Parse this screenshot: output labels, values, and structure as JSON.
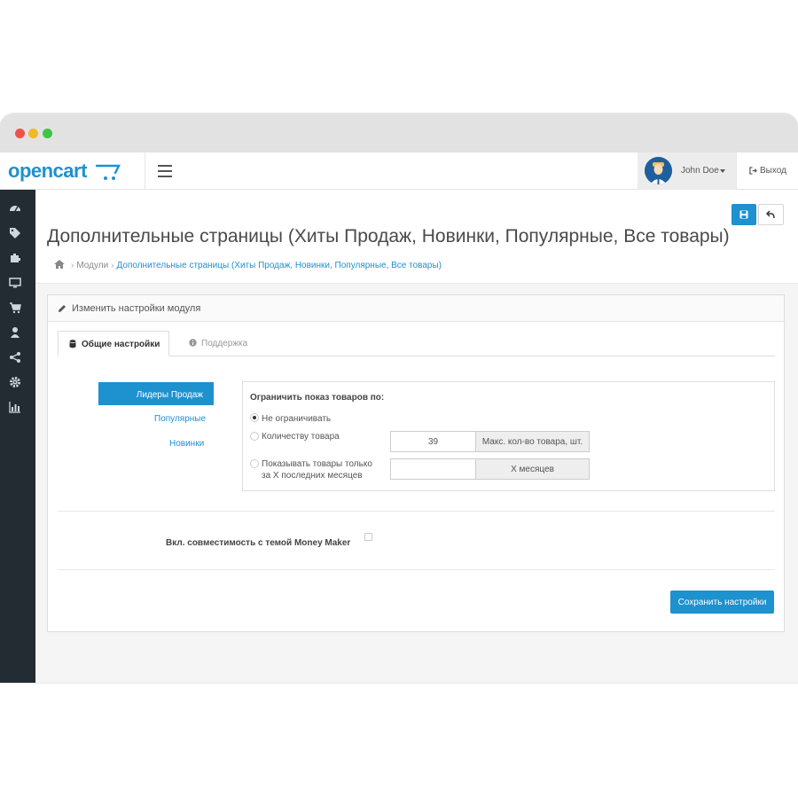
{
  "header": {
    "logo_text": "opencart",
    "user_name": "John Doe",
    "logout_label": "Выход"
  },
  "sidebar": {
    "icons": [
      "dashboard-icon",
      "tag-icon",
      "puzzle-icon",
      "monitor-icon",
      "cart-icon",
      "user-icon",
      "share-icon",
      "gear-icon",
      "bar-chart-icon"
    ]
  },
  "page": {
    "title": "Дополнительные страницы (Хиты Продаж, Новинки, Популярные, Все товары)",
    "breadcrumb": {
      "modules": "Модули",
      "current": "Дополнительные страницы (Хиты Продаж, Новинки, Популярные, Все товары)"
    }
  },
  "panel": {
    "title": "Изменить настройки модуля",
    "tabs": [
      {
        "label": "Общие настройки",
        "active": true
      },
      {
        "label": "Поддержка",
        "active": false
      }
    ],
    "vertical_nav": [
      "Лидеры Продаж",
      "Популярные",
      "Новинки"
    ],
    "filter": {
      "title": "Ограничить показ товаров по:",
      "options": [
        {
          "label": "Не ограничивать",
          "checked": true
        },
        {
          "label": "Количеству товара",
          "checked": false
        },
        {
          "label_line1": "Показывать товары только",
          "label_line2": "за X последних месяцев",
          "checked": false
        }
      ],
      "quantity_value": "39",
      "quantity_addon": "Макс. кол-во товара, шт.",
      "months_value": "",
      "months_addon": "X месяцев"
    },
    "compat_label": "Вкл. совместимость с темой Money Maker",
    "compat_checked": false,
    "save_button": "Сохранить настройки"
  },
  "colors": {
    "accent": "#1e91cf",
    "sidebar_bg": "#222c32"
  }
}
